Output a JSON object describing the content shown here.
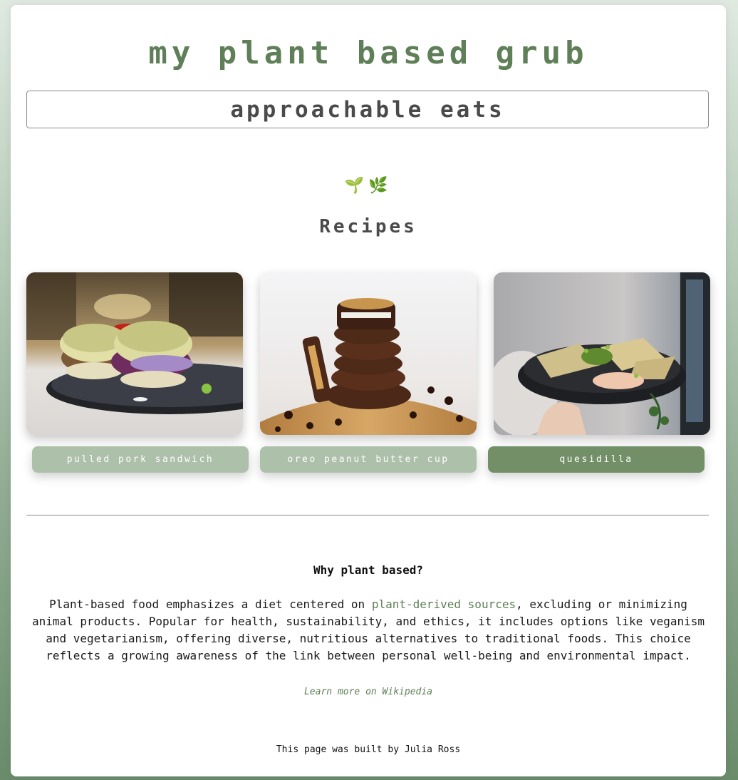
{
  "header": {
    "title": "my plant based grub",
    "tagline": "approachable eats"
  },
  "section": {
    "icons": [
      "sprout-icon",
      "herb-icon"
    ],
    "emoji_sprout": "🌱",
    "emoji_herb": "🌿",
    "heading": "Recipes"
  },
  "recipes": [
    {
      "label": "pulled pork sandwich",
      "image": "pulled pork sandwich photo",
      "active": false
    },
    {
      "label": "oreo peanut butter cup",
      "image": "oreo peanut butter cup photo",
      "active": false
    },
    {
      "label": "quesidilla",
      "image": "quesadilla photo",
      "active": true
    }
  ],
  "about": {
    "heading": "Why plant based?",
    "text_before": "Plant-based food emphasizes a diet centered on ",
    "link_text": "plant-derived sources",
    "text_after": ", excluding or minimizing animal products. Popular for health, sustainability, and ethics, it includes options like veganism and vegetarianism, offering diverse, nutritious alternatives to traditional foods. This choice reflects a growing awareness of the link between personal well-being and environmental impact.",
    "wiki_link": "Learn more on Wikipedia"
  },
  "footer": {
    "text": "This page was built by Julia Ross"
  },
  "colors": {
    "accent": "#5e7f57",
    "button_light": "#adc0aa",
    "button_active": "#728f67"
  }
}
